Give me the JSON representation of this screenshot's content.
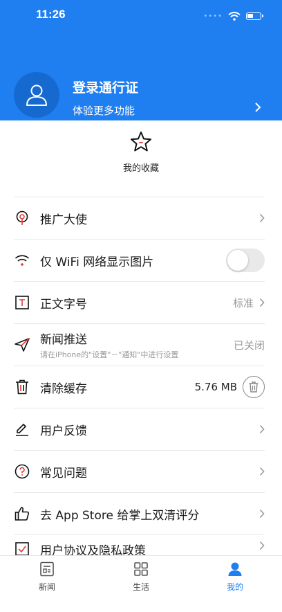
{
  "status_bar": {
    "time": "11:26"
  },
  "header": {
    "login_title": "登录通行证",
    "login_subtitle": "体验更多功能",
    "accent": "#1f7ef0"
  },
  "favorites": {
    "label": "我的收藏",
    "icon": "star-icon"
  },
  "settings": {
    "items": [
      {
        "label": "推广大使",
        "icon": "ambassador-icon"
      },
      {
        "label": "仅 WiFi 网络显示图片",
        "icon": "wifi-icon",
        "toggle_on": false
      },
      {
        "label": "正文字号",
        "icon": "font-size-icon",
        "value": "标准"
      },
      {
        "label": "新闻推送",
        "icon": "send-icon",
        "hint": "请在iPhone的\"设置\"－\"通知\"中进行设置",
        "value": "已关闭"
      },
      {
        "label": "清除缓存",
        "icon": "trash-icon",
        "value": "5.76 MB"
      },
      {
        "label": "用户反馈",
        "icon": "edit-icon"
      },
      {
        "label": "常见问题",
        "icon": "question-icon"
      },
      {
        "label": "去 App Store 给掌上双清评分",
        "icon": "thumbs-up-icon"
      },
      {
        "label": "用户协议及隐私政策",
        "icon": "checkbox-icon"
      }
    ]
  },
  "tabbar": {
    "tabs": [
      {
        "label": "新闻",
        "icon": "news-icon"
      },
      {
        "label": "生活",
        "icon": "grid-icon"
      },
      {
        "label": "我的",
        "icon": "profile-icon",
        "active": true
      }
    ]
  }
}
